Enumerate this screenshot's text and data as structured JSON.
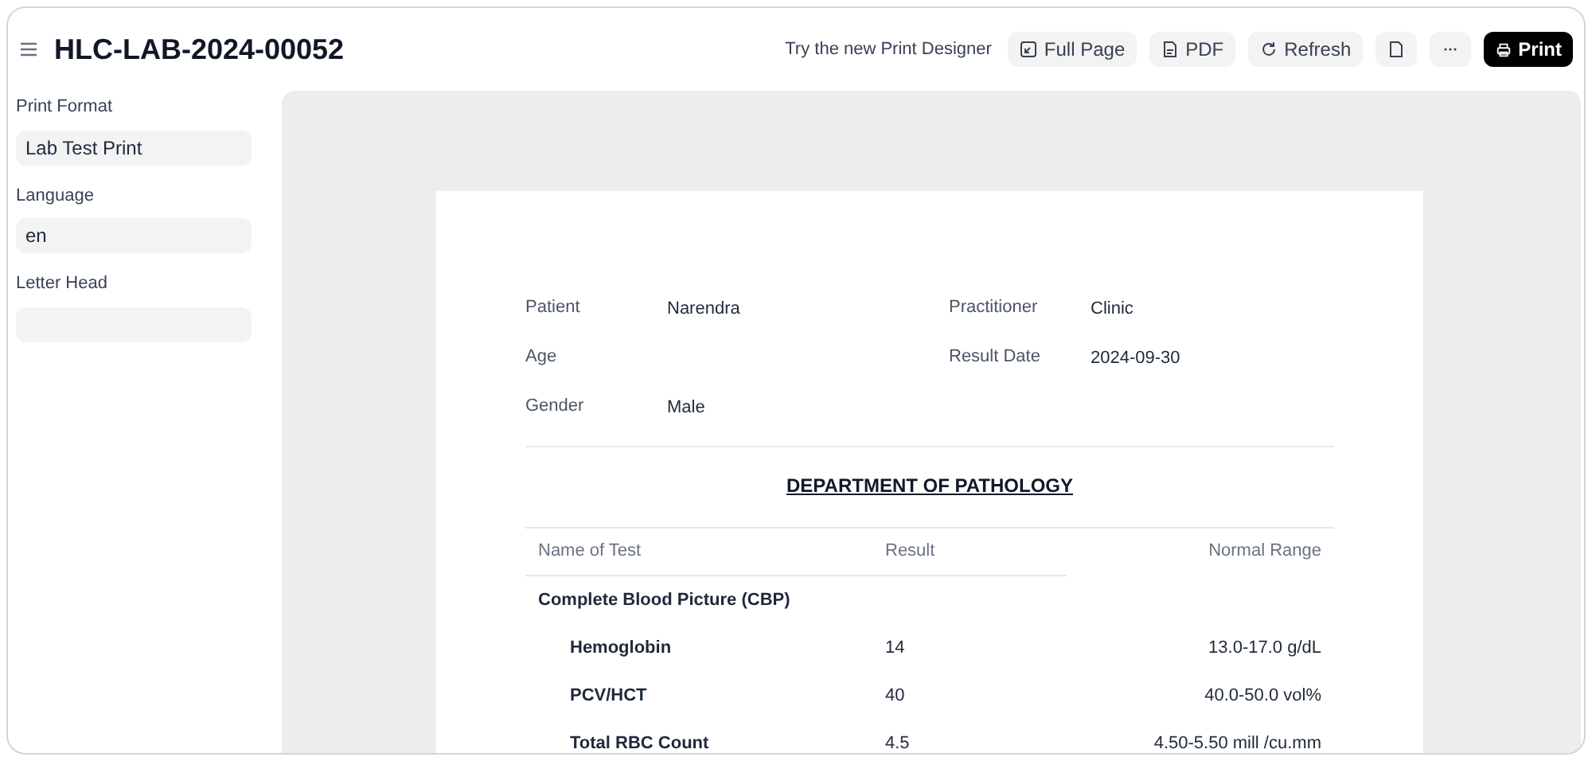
{
  "window": {
    "title": "HLC-LAB-2024-00052"
  },
  "toolbar": {
    "link": "Try the new Print Designer",
    "buttons": [
      {
        "kind": "full-page",
        "label": "Full Page"
      },
      {
        "kind": "pdf",
        "label": "PDF"
      },
      {
        "kind": "refresh",
        "label": "Refresh"
      },
      {
        "kind": "page"
      },
      {
        "kind": "more"
      },
      {
        "kind": "print",
        "label": "Print"
      }
    ]
  },
  "sidebar": {
    "fields": [
      {
        "label": "Print Format",
        "value": "Lab Test Print"
      },
      {
        "label": "Language",
        "value": "en"
      },
      {
        "label": "Letter Head"
      }
    ]
  },
  "document": {
    "info": [
      {
        "label": "Patient",
        "value": "Narendra"
      },
      {
        "label": "Practitioner",
        "value": "Clinic"
      },
      {
        "label": "Age"
      },
      {
        "label": "Result Date",
        "value": "2024-09-30"
      },
      {
        "label": "Gender",
        "value": "Male"
      }
    ],
    "heading": "DEPARTMENT OF PATHOLOGY",
    "table": {
      "columns": [
        "Name of Test",
        "Result",
        "Normal Range"
      ],
      "rows": [
        {
          "kind": "group",
          "name": "Complete Blood Picture (CBP)"
        },
        {
          "kind": "test",
          "name": "Hemoglobin",
          "result": "14",
          "range": "13.0-17.0 g/dL"
        },
        {
          "kind": "test",
          "name": "PCV/HCT",
          "result": "40",
          "range": "40.0-50.0 vol%"
        },
        {
          "kind": "test",
          "name": "Total RBC Count",
          "result": "4.5",
          "range": "4.50-5.50 mill /cu.mm"
        }
      ]
    }
  }
}
